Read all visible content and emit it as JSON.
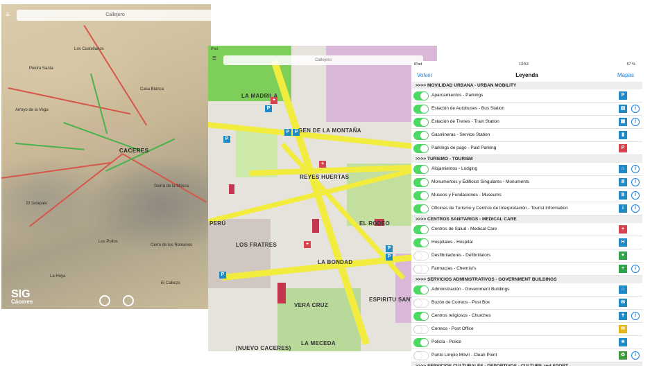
{
  "topo_screen": {
    "search_label": "Callejero",
    "city_label": "CACERES",
    "place_labels": [
      "Piedra Santa",
      "Los Castellanos",
      "Arroyo de la Vega",
      "Casa Blanca",
      "El Jarapalo",
      "Los Pollos",
      "Cerro de los Romanos",
      "Sierra de la Mosca",
      "La Hoya",
      "El Cabezo"
    ],
    "logo_title": "SIG",
    "logo_subtitle": "Cáceres"
  },
  "street_screen": {
    "status_device": "iPad",
    "search_label": "Callejero",
    "labels": [
      "LA MADRILA",
      "GEN DE LA MONTAÑA",
      "REYES HUERTAS",
      "PERÚ",
      "LOS FRATRES",
      "LA BONDAD",
      "EL RODEO",
      "VERA CRUZ",
      "ESPIRITU SANTO",
      "LA MECEDA",
      "(NUEVO CACERES)"
    ],
    "pin_letter": "P",
    "cross_symbol": "+"
  },
  "legend_screen": {
    "status_device": "iPad",
    "status_time": "13:53",
    "status_battery": "57 %",
    "back_label": "Volver",
    "title": "Leyenda",
    "maps_label": "Mapas",
    "sections": [
      {
        "title": ">>>> MOVILIDAD URBANA -  URBAN MOBILITY"
      },
      {
        "title": ">>>> TURISMO - TOURISM"
      },
      {
        "title": ">>>> CENTROS SANITARIOS - MEDICAL CARE"
      },
      {
        "title": ">>>> SERVICIOS ADMINISTRATIVOS - GOVERNMENT BUILDINGS"
      },
      {
        "title": ">>>> SERVICIOS CULTURALES - DEPORTIVOS - CULTURE and SPORT"
      }
    ],
    "rows": [
      {
        "label": "Aparcamientos - Parkings",
        "on": true,
        "icon": "parking-icon",
        "glyph": "P",
        "color": "#1f8ac4",
        "info": false
      },
      {
        "label": "Estación de Autobuses - Bus Station",
        "on": true,
        "icon": "bus-icon",
        "glyph": "▤",
        "color": "#1f8ac4",
        "info": true
      },
      {
        "label": "Estación de Trenes - Train Station",
        "on": true,
        "icon": "train-icon",
        "glyph": "▦",
        "color": "#1f8ac4",
        "info": true
      },
      {
        "label": "Gasolineras - Service Station",
        "on": true,
        "icon": "fuel-icon",
        "glyph": "▮",
        "color": "#1f8ac4",
        "info": false
      },
      {
        "label": "Parkings de pago - Paid Parking",
        "on": true,
        "icon": "paid-parking-icon",
        "glyph": "P",
        "color": "#d6424e",
        "info": false
      },
      {
        "label": "Alojamientos - Lodging",
        "on": true,
        "icon": "bed-icon",
        "glyph": "⌂",
        "color": "#1f8ac4",
        "info": true
      },
      {
        "label": "Monumentos y Edificios Singulares - Monuments",
        "on": true,
        "icon": "monument-icon",
        "glyph": "Ⅲ",
        "color": "#1f8ac4",
        "info": true
      },
      {
        "label": "Museos y Fundaciones  - Museums",
        "on": true,
        "icon": "museum-icon",
        "glyph": "Ⅲ",
        "color": "#1f8ac4",
        "info": true
      },
      {
        "label": "Oficinas de Turismo y Centros de Interpretación - Tourist Information",
        "on": true,
        "icon": "tourist-info-icon",
        "glyph": "i",
        "color": "#1f8ac4",
        "info": true
      },
      {
        "label": "Centros de Salud - Medical Care",
        "on": true,
        "icon": "medical-cross-icon",
        "glyph": "+",
        "color": "#d6424e",
        "info": false
      },
      {
        "label": "Hospitales - Hospital",
        "on": true,
        "icon": "hospital-icon",
        "glyph": "H",
        "color": "#1f8ac4",
        "info": false
      },
      {
        "label": "Desfibriladores - Defibrillators",
        "on": false,
        "icon": "defibrillator-icon",
        "glyph": "♥",
        "color": "#2fa24a",
        "info": false
      },
      {
        "label": "Farmacias - Chemist's",
        "on": false,
        "icon": "pharmacy-icon",
        "glyph": "+",
        "color": "#2fa24a",
        "info": true
      },
      {
        "label": "Administración - Government Buildings",
        "on": true,
        "icon": "government-icon",
        "glyph": "⌂",
        "color": "#1f8ac4",
        "info": false
      },
      {
        "label": "Buzón de Correos - Post Box",
        "on": false,
        "icon": "mailbox-icon",
        "glyph": "✉",
        "color": "#1f8ac4",
        "info": false
      },
      {
        "label": "Centros religiosos - Churches",
        "on": true,
        "icon": "church-icon",
        "glyph": "✝",
        "color": "#1f8ac4",
        "info": true
      },
      {
        "label": "Correos - Post Office",
        "on": false,
        "icon": "post-office-icon",
        "glyph": "✉",
        "color": "#e6b619",
        "info": false
      },
      {
        "label": "Policía - Police",
        "on": true,
        "icon": "police-icon",
        "glyph": "★",
        "color": "#1f8ac4",
        "info": false
      },
      {
        "label": "Punto Limpio Móvil - Clean Point",
        "on": false,
        "icon": "recycle-icon",
        "glyph": "♻",
        "color": "#3e9a3a",
        "info": true
      }
    ]
  }
}
